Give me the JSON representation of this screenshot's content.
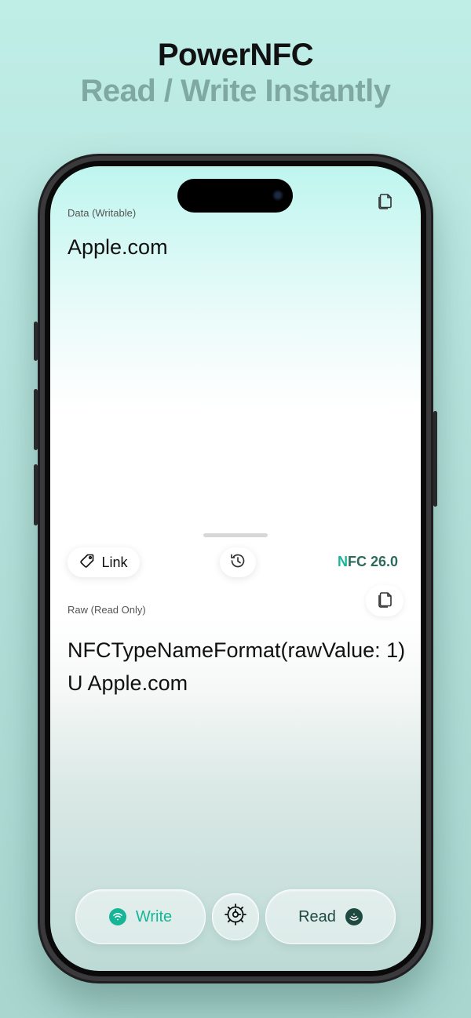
{
  "promo": {
    "title": "PowerNFC",
    "subtitle": "Read / Write Instantly"
  },
  "app": {
    "data_section": {
      "label": "Data (Writable)",
      "value": "Apple.com"
    },
    "record_type_label": "Link",
    "version": {
      "accent": "N",
      "rest": "FC 26.0"
    },
    "raw_section": {
      "label": "Raw (Read Only)",
      "value": "NFCTypeNameFormat(rawValue: 1) U  Apple.com"
    },
    "actions": {
      "write_label": "Write",
      "read_label": "Read"
    },
    "icons": {
      "copy": "copy-icon",
      "tag": "tag-icon",
      "history": "history-icon",
      "settings": "gear-icon",
      "write": "write-nfc-icon",
      "read": "read-nfc-icon"
    },
    "colors": {
      "accent": "#16b597",
      "dark_accent": "#1f4a41"
    }
  }
}
